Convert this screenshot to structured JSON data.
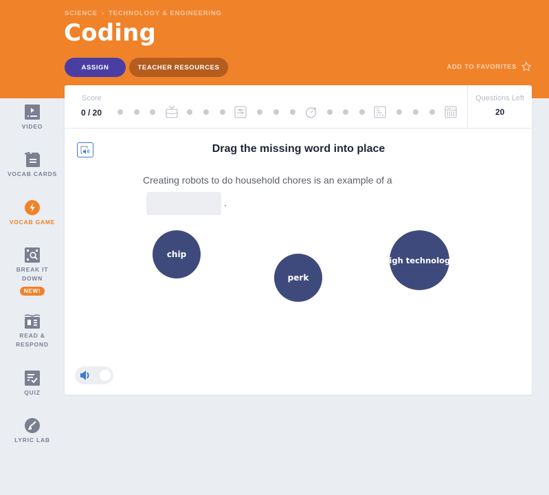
{
  "header": {
    "breadcrumb": [
      "SCIENCE",
      "TECHNOLOGY & ENGINEERING"
    ],
    "breadcrumb_separator": "›",
    "title": "Coding",
    "assign_label": "ASSIGN",
    "teacher_resources_label": "TEACHER RESOURCES",
    "favorites_label": "ADD TO FAVORITES",
    "favorites_icon": "star-outline-icon"
  },
  "colors": {
    "header_bg": "#f0822a",
    "assign_bg": "#4b3ea3",
    "teacher_bg": "#b45d1f",
    "bubble_bg": "#3e4a7b",
    "active_nav": "#f0822a",
    "page_bg": "#eaedf1"
  },
  "sidebar": {
    "items": [
      {
        "label": "VIDEO",
        "icon": "video-icon",
        "active": false
      },
      {
        "label": "VOCAB CARDS",
        "icon": "vocab-cards-icon",
        "active": false
      },
      {
        "label": "VOCAB GAME",
        "icon": "lightning-icon",
        "active": true
      },
      {
        "label": "BREAK IT DOWN",
        "icon": "magnify-icon",
        "active": false,
        "badge": "NEW!"
      },
      {
        "label": "READ & RESPOND",
        "icon": "book-icon",
        "active": false
      },
      {
        "label": "QUIZ",
        "icon": "quiz-checklist-icon",
        "active": false
      },
      {
        "label": "LYRIC LAB",
        "icon": "lyric-lab-icon",
        "active": false
      }
    ]
  },
  "game": {
    "score_label": "Score",
    "score_value": "0 / 20",
    "questions_left_label": "Questions Left",
    "questions_left_value": "20",
    "progress_steps": [
      "dot",
      "dot",
      "dot",
      "tv-icon",
      "dot",
      "dot",
      "dot",
      "sliders-icon",
      "dot",
      "dot",
      "dot",
      "stopwatch-icon",
      "dot",
      "dot",
      "dot",
      "chart-icon",
      "dot",
      "dot",
      "dot",
      "calculator-icon"
    ],
    "prompt": "Drag the missing word into place",
    "sentence": "Creating robots to do household chores is an example of a",
    "sentence_end": ".",
    "options": [
      "chip",
      "perk",
      "high technology"
    ],
    "sound_on": false
  }
}
